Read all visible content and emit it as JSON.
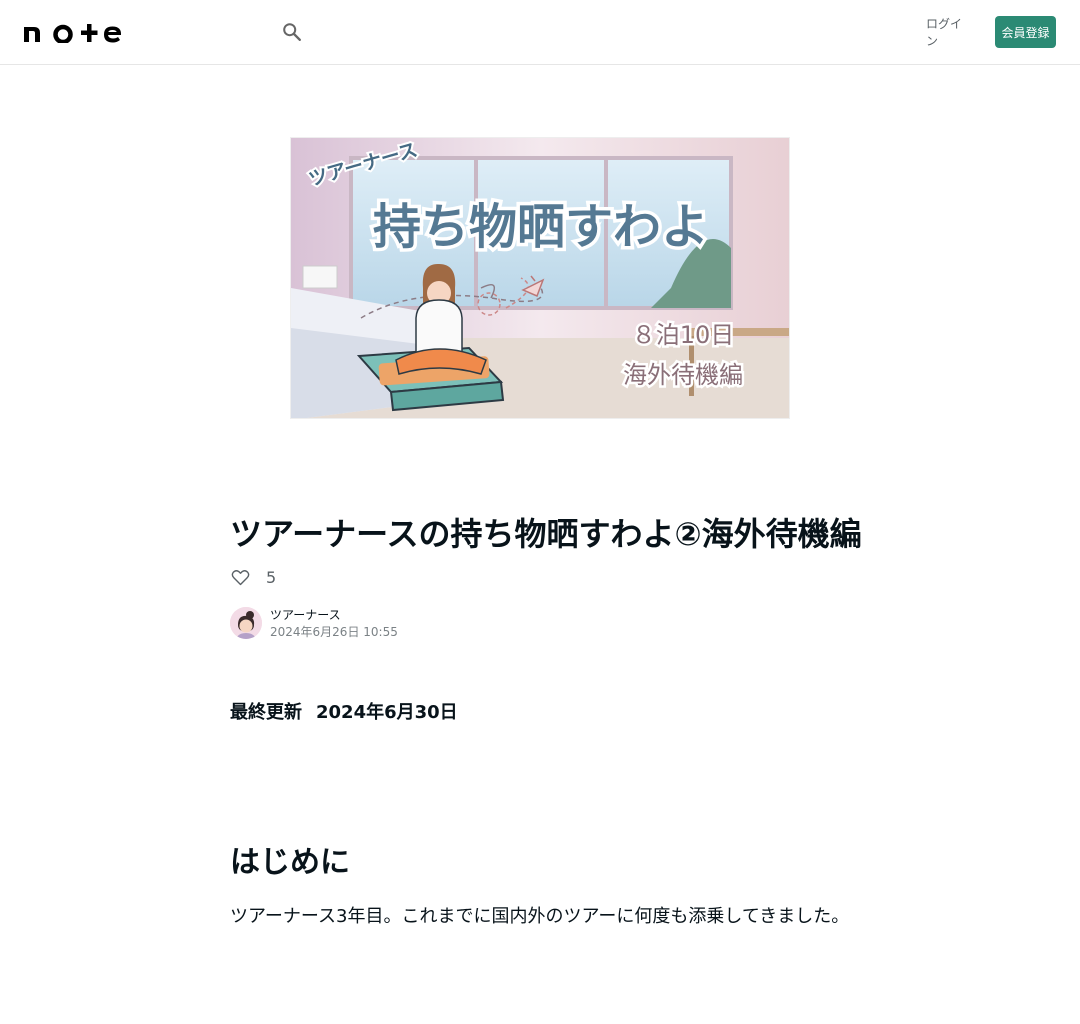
{
  "header": {
    "logo_text": "note",
    "login_label": "ログイン",
    "signup_label": "会員登録"
  },
  "hero": {
    "subtitle": "ツアーナース",
    "title": "持ち物晒すわよ",
    "nights": "８泊10日",
    "edition": "海外待機編"
  },
  "article": {
    "title": "ツアーナースの持ち物晒すわよ②海外待機編",
    "like_count": "5",
    "author_name": "ツアーナース",
    "post_date": "2024年6月26日 10:55",
    "update_label": "最終更新",
    "update_date": "2024年6月30日",
    "section_heading": "はじめに",
    "body_text": "ツアーナース3年目。これまでに国内外のツアーに何度も添乗してきました。"
  },
  "colors": {
    "accent": "#2b8a74",
    "text": "#08131a",
    "muted": "#5a6166"
  },
  "icons": {
    "search": "search-icon",
    "like": "heart-icon"
  }
}
